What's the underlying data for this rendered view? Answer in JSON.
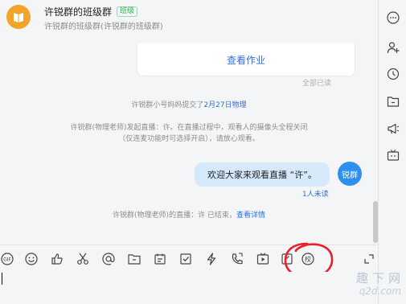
{
  "header": {
    "title": "许锐群的班级群",
    "badge": "班级",
    "subtitle": "许锐群的班级群(许锐群的班级群)"
  },
  "messages": {
    "card_button": "查看作业",
    "read_all": "全部已读",
    "submit_prefix": "许锐群小号妈妈提交了",
    "submit_link": "2月27日物理",
    "live_notice_line1": "许锐群(物理老师)发起直播：许。在直播过程中，观看人的摄像头全程关闭",
    "live_notice_line2": "（仅连麦功能时可选择开启），请放心观看。",
    "my_message": "欢迎大家来观看直播 “许”。",
    "my_avatar_text": "锐群",
    "unread": "1人未读",
    "live_end_prefix": "许锐群(物理老师)的直播：许 已结束，",
    "live_end_link": "查看详情"
  },
  "toolbar_icons": [
    "gif-icon",
    "emoji-icon",
    "thumbs-up-icon",
    "scissors-icon",
    "at-icon",
    "folder-icon",
    "calendar-icon",
    "checkbox-icon",
    "lightning-icon",
    "phone-icon",
    "live-video-icon",
    "feedback-icon",
    "school-icon",
    "expand-icon"
  ],
  "sidebar_icons": [
    "more-icon",
    "add-member-icon",
    "history-icon",
    "files-icon",
    "announcement-icon",
    "tv-icon"
  ],
  "colors": {
    "accent": "#2f6fe0",
    "bubble": "#d6e9fb",
    "avatar": "#f3a32a",
    "annotation": "#e8202a"
  },
  "watermark": {
    "line1": "趣下网",
    "line2": "q2d.com"
  }
}
